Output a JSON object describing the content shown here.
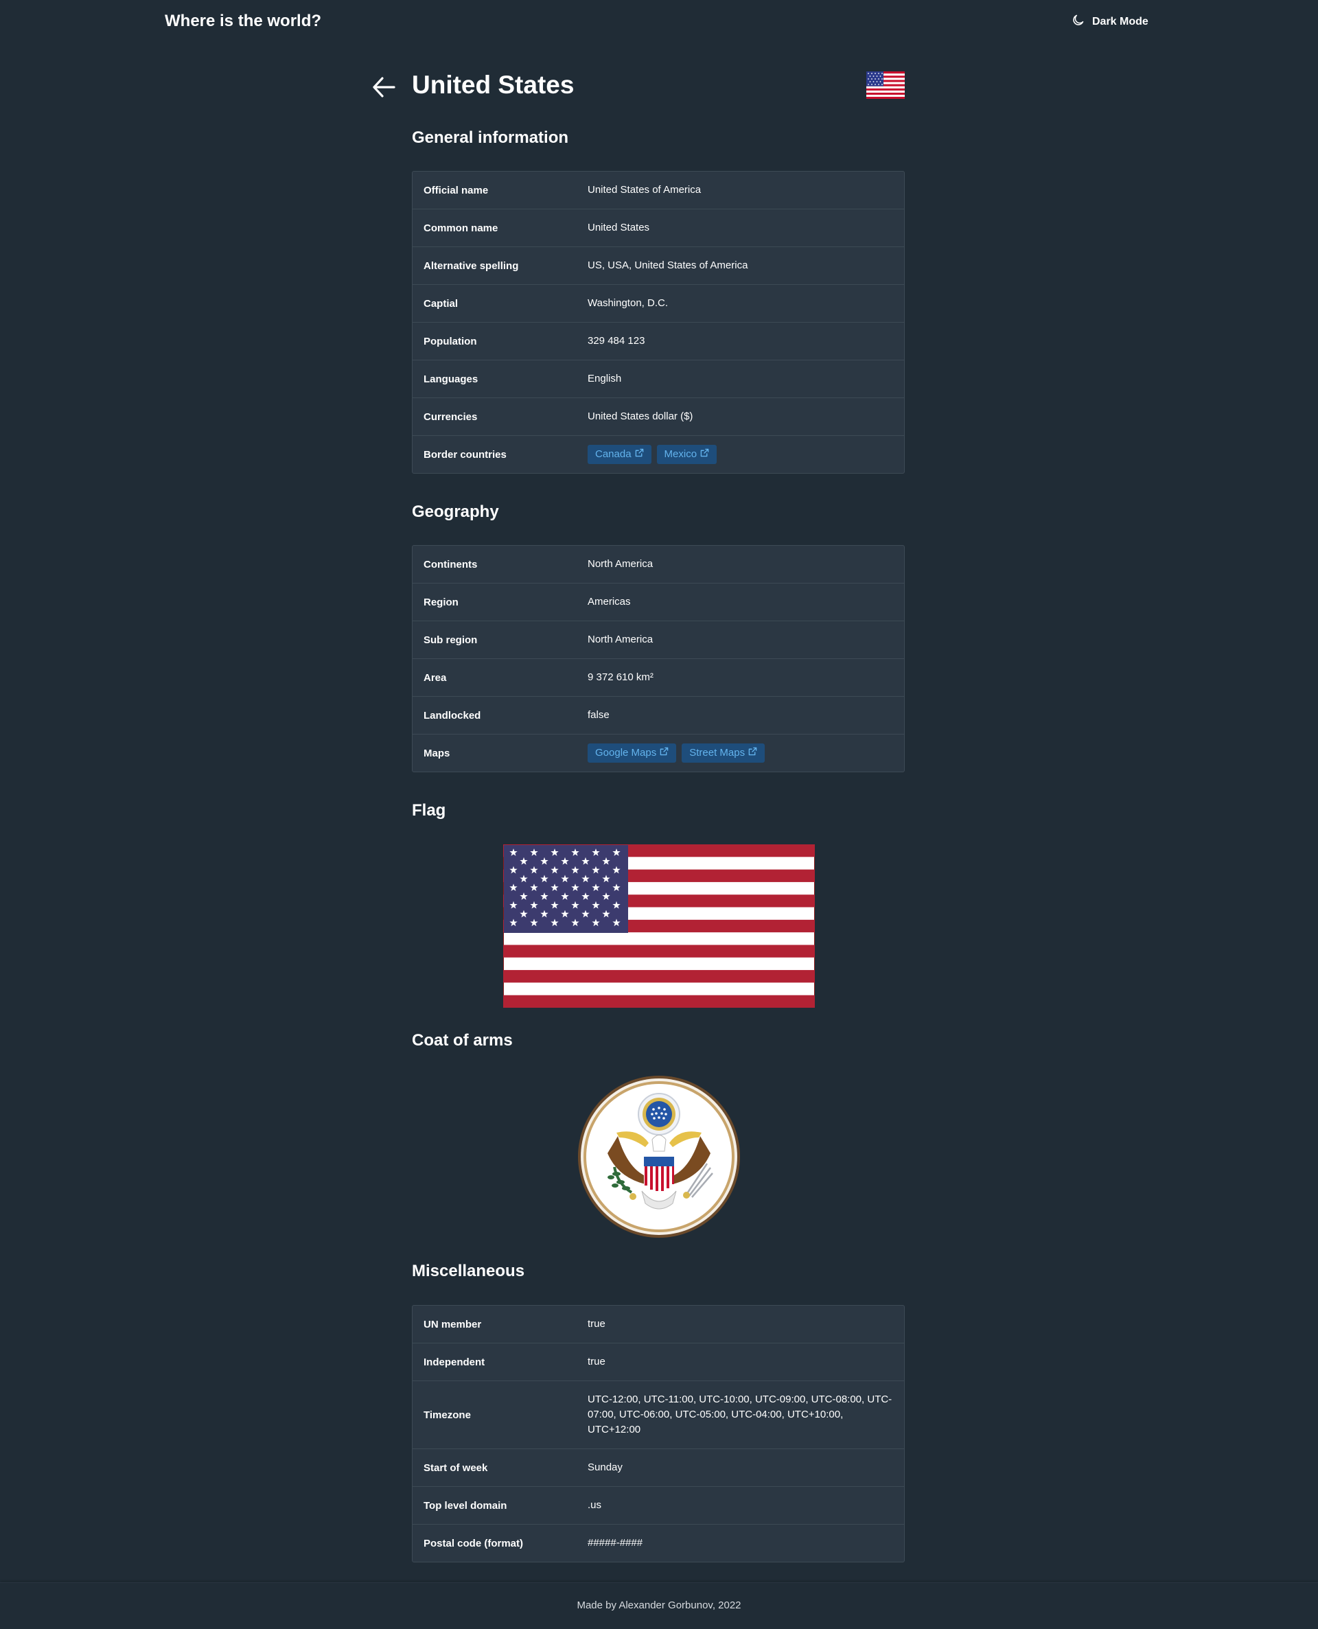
{
  "header": {
    "title": "Where is the world?",
    "mode_label": "Dark Mode",
    "mode_icon": "moon-icon"
  },
  "country": {
    "name": "United States",
    "emoji_flag_icon": "us-flag-icon"
  },
  "sections": {
    "general": "General information",
    "geography": "Geography",
    "flag": "Flag",
    "coat_of_arms": "Coat of arms",
    "misc": "Miscellaneous"
  },
  "general": [
    {
      "key": "Official name",
      "value": "United States of America"
    },
    {
      "key": "Common name",
      "value": "United States"
    },
    {
      "key": "Alternative spelling",
      "value": "US, USA, United States of America"
    },
    {
      "key": "Captial",
      "value": "Washington, D.C."
    },
    {
      "key": "Population",
      "value": "329 484 123"
    },
    {
      "key": "Languages",
      "value": "English"
    },
    {
      "key": "Currencies",
      "value": "United States dollar ($)"
    },
    {
      "key": "Border countries",
      "links": [
        "Canada",
        "Mexico"
      ]
    }
  ],
  "geography": [
    {
      "key": "Continents",
      "value": "North America"
    },
    {
      "key": "Region",
      "value": "Americas"
    },
    {
      "key": "Sub region",
      "value": "North America"
    },
    {
      "key": "Area",
      "value": "9 372 610 km²"
    },
    {
      "key": "Landlocked",
      "value": "false"
    },
    {
      "key": "Maps",
      "links": [
        "Google Maps",
        "Street Maps"
      ]
    }
  ],
  "misc": [
    {
      "key": "UN member",
      "value": "true"
    },
    {
      "key": "Independent",
      "value": "true"
    },
    {
      "key": "Timezone",
      "value": "UTC-12:00, UTC-11:00, UTC-10:00, UTC-09:00, UTC-08:00, UTC-07:00, UTC-06:00, UTC-05:00, UTC-04:00, UTC+10:00, UTC+12:00"
    },
    {
      "key": "Start of week",
      "value": "Sunday"
    },
    {
      "key": "Top level domain",
      "value": ".us"
    },
    {
      "key": "Postal code (format)",
      "value": "#####-####"
    }
  ],
  "footer": {
    "text": "Made by Alexander Gorbunov, 2022"
  },
  "colors": {
    "background": "#202c36",
    "table_bg": "#2b3743",
    "badge_bg": "#1e4d7b",
    "badge_text": "#63b3ed",
    "flag_red": "#b22234",
    "flag_blue": "#3c3b6e"
  }
}
